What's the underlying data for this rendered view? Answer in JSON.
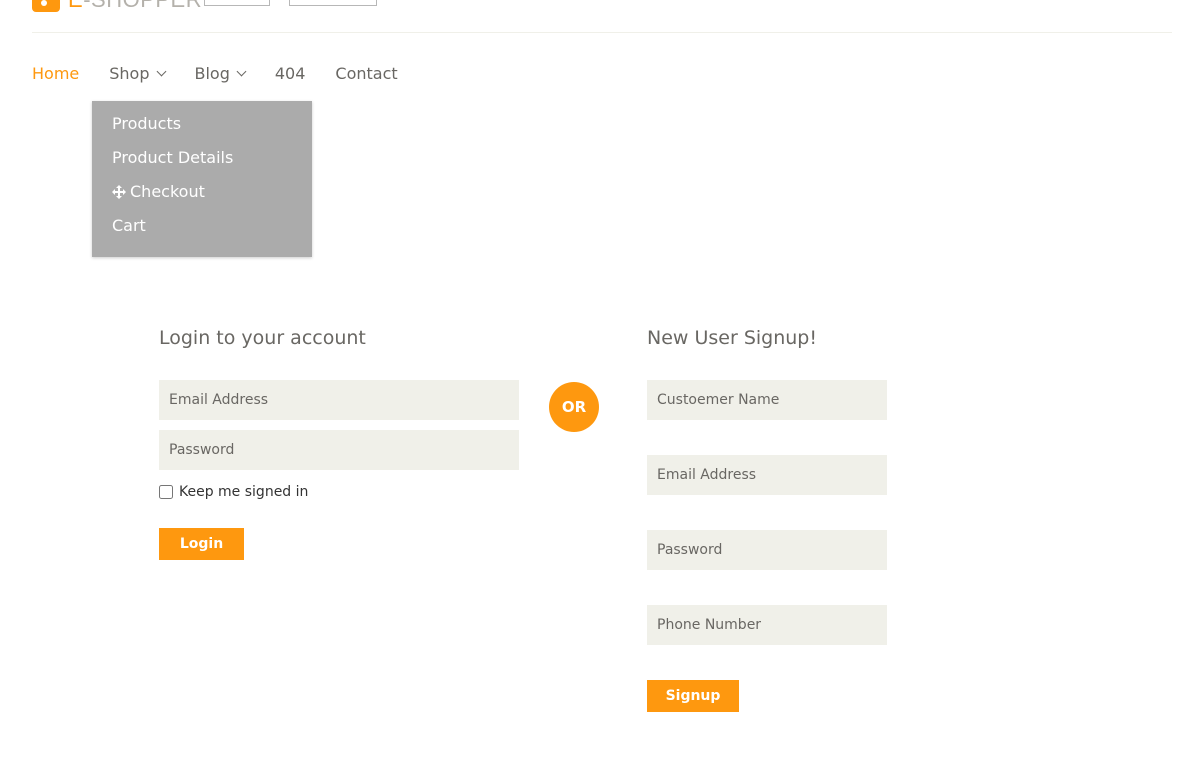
{
  "header": {
    "logo_icon": "shopping-bag-icon",
    "logo_prefix": "E",
    "logo_rest": "-SHOPPER"
  },
  "nav": {
    "items": [
      {
        "label": "Home",
        "active": true
      },
      {
        "label": "Shop",
        "has_dropdown": true
      },
      {
        "label": "Blog",
        "has_dropdown": true
      },
      {
        "label": "404"
      },
      {
        "label": "Contact"
      }
    ]
  },
  "shop_dropdown": {
    "items": [
      {
        "label": "Products"
      },
      {
        "label": "Product Details"
      },
      {
        "label": "Checkout",
        "icon": "move-cross-icon"
      },
      {
        "label": "Cart"
      }
    ]
  },
  "login": {
    "title": "Login to your account",
    "email_placeholder": "Email Address",
    "password_placeholder": "Password",
    "keep_signed_in_label": "Keep me signed in",
    "keep_signed_in_checked": false,
    "button_label": "Login"
  },
  "or_label": "OR",
  "signup": {
    "title": "New User Signup!",
    "name_placeholder": "Custoemer Name",
    "email_placeholder": "Email Address",
    "password_placeholder": "Password",
    "phone_placeholder": "Phone Number",
    "button_label": "Signup"
  },
  "colors": {
    "accent": "#FE980F",
    "field_bg": "#F0F0E9",
    "text": "#696763",
    "dropdown_bg": "#A8A8A8"
  }
}
